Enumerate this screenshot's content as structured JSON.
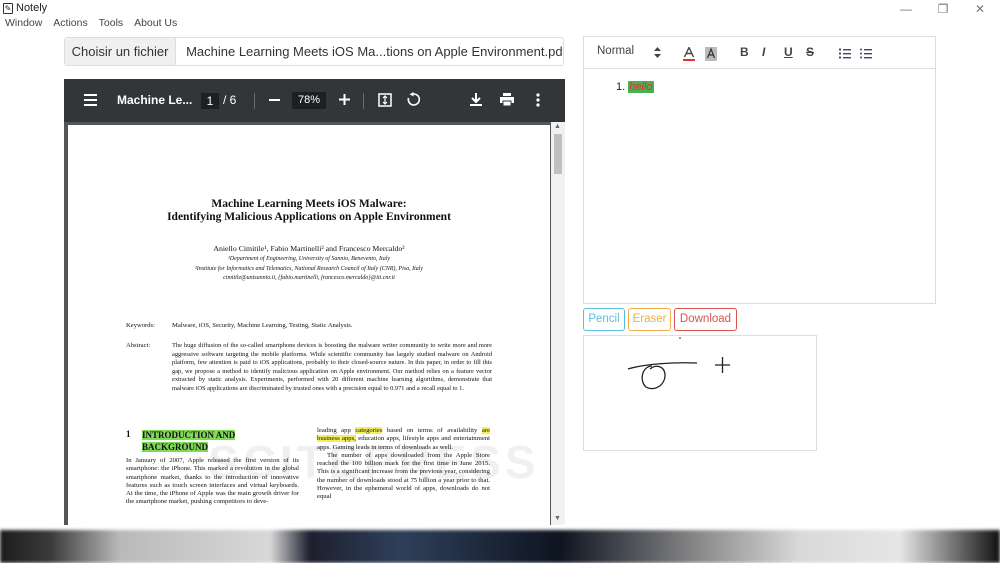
{
  "window": {
    "title": "Notely",
    "icon": "notely-app-icon",
    "controls": {
      "minimize": "—",
      "restore": "❐",
      "close": "✕"
    }
  },
  "menu": [
    "Window",
    "Actions",
    "Tools",
    "About Us"
  ],
  "file": {
    "choose_label": "Choisir un fichier",
    "filename": "Machine Learning Meets iOS Ma...tions on Apple Environment.pdf"
  },
  "pdf_toolbar": {
    "doc_title": "Machine Le...",
    "page_current": "1",
    "page_total": "/ 6",
    "zoom": "78%"
  },
  "pdf_page": {
    "title_line1": "Machine Learning Meets iOS Malware:",
    "title_line2": "Identifying Malicious Applications on Apple Environment",
    "authors": "Aniello Cimitile¹, Fabio Martinelli² and Francesco Mercaldo²",
    "affil1": "¹Department of Engineering, University of Sannio, Benevento, Italy",
    "affil2": "²Institute for Informatics and Telematics, National Research Council of Italy (CNR), Pisa, Italy",
    "emails": "cimitile@unisannio.it, {fabio.martinelli, francesco.mercaldo}@iit.cnr.it",
    "keywords_label": "Keywords:",
    "keywords": "Malware, iOS, Security, Machine Learning, Testing, Static Analysis.",
    "abstract_label": "Abstract:",
    "abstract": "The huge diffusion of the so-called smartphone devices is boosting the malware writer community to write more and more aggressive software targeting the mobile platforms. While scientific community has largely studied malware on Android platform, few attention is paid to iOS applications, probably to their closed-source nature. In this paper, in order to fill this gap, we propose a method to identify malicious application on Apple environment. Our method relies on a feature vector extracted by static analysis. Experiments, performed with 20 different machine learning algorithms, demonstrate that malware iOS applications are discriminated by trusted ones with a precision equal to 0.971 and a recall equal to 1.",
    "section_num": "1",
    "section_title_1": "INTRODUCTION AND",
    "section_title_2": "BACKGROUND",
    "left_col": "In January of 2007, Apple released the first version of its smartphone: the iPhone. This marked a revolution in the global smartphone market, thanks to the introduction of innovative features such as touch screen interfaces and virtual keyboards. At the time, the iPhone of Apple was the main growth driver for the smartphone market, pushing competitors to deve-",
    "right_col_a": "leading app ",
    "right_col_hl1": "categories",
    "right_col_b": " based on terms of availability ",
    "right_col_hl2": "are business apps,",
    "right_col_c": " education apps, lifestyle apps and entertainment apps. Gaming leads in terms of downloads as well.",
    "right_col_d": "The number of apps downloaded from the Apple Store reached the 100 billion mark for the first time in June 2015. This is a significant increase from the previous year, considering the number of downloads stood at 75 billion a year prior to that. However, in the ephemeral world of apps, downloads do not equal",
    "watermark": "SCITEPRESS"
  },
  "editor": {
    "format": "Normal",
    "list_item": "1.",
    "list_text": "hello"
  },
  "tools": {
    "pencil": "Pencil",
    "eraser": "Eraser",
    "download": "Download"
  },
  "colors": {
    "pencil": "#5bc0de",
    "eraser": "#f0ad4e",
    "download": "#d9534f"
  }
}
